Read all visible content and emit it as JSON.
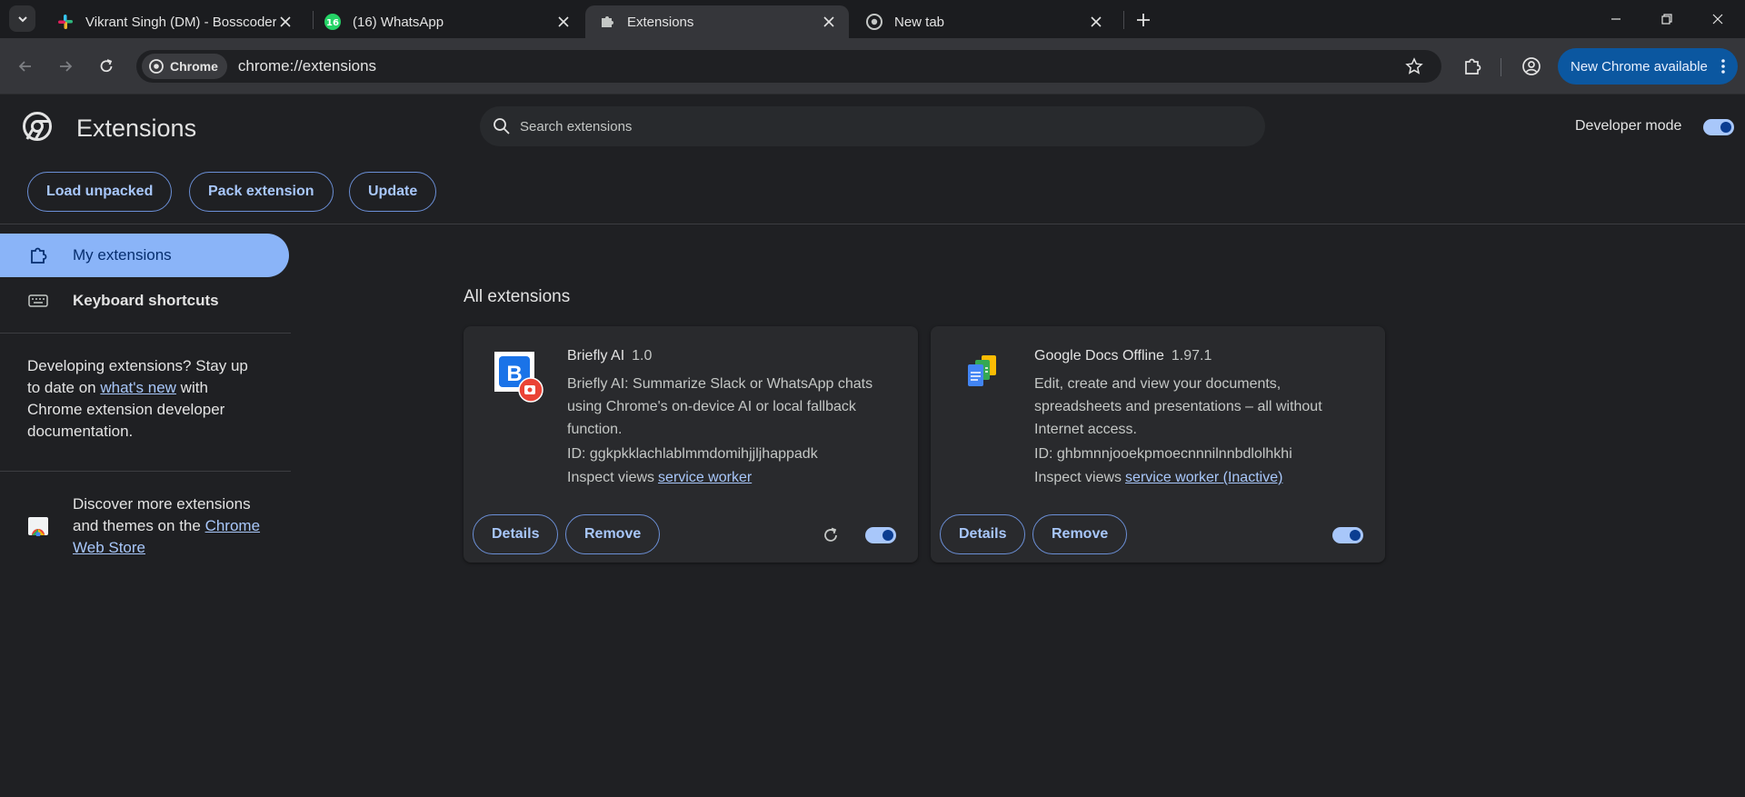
{
  "tabs": [
    {
      "title": "Vikrant Singh (DM) - Bosscoder",
      "favicon": "slack-icon",
      "active": false
    },
    {
      "title": "(16) WhatsApp",
      "favicon": "whatsapp-icon",
      "badge": "16",
      "active": false
    },
    {
      "title": "Extensions",
      "favicon": "puzzle-icon",
      "active": true
    },
    {
      "title": "New tab",
      "favicon": "chrome-icon",
      "active": false
    }
  ],
  "toolbar": {
    "chip_label": "Chrome",
    "url": "chrome://extensions",
    "update_label": "New Chrome available"
  },
  "header": {
    "title": "Extensions",
    "search_placeholder": "Search extensions",
    "dev_mode_label": "Developer mode",
    "dev_mode_on": true,
    "buttons": [
      "Load unpacked",
      "Pack extension",
      "Update"
    ]
  },
  "sidebar": {
    "items": [
      {
        "label": "My extensions",
        "active": true
      },
      {
        "label": "Keyboard shortcuts",
        "active": false
      }
    ],
    "dev_text_before": "Developing extensions? Stay up to date on",
    "dev_link": "what's new",
    "dev_text_after": "with Chrome extension developer documentation.",
    "store_text": "Discover more extensions and themes on the",
    "store_link": "Chrome Web Store"
  },
  "main": {
    "section_title": "All extensions",
    "extensions": [
      {
        "name": "Briefly AI",
        "version": "1.0",
        "description": "Briefly AI: Summarize Slack or WhatsApp chats using Chrome's on-device AI or local fallback function.",
        "id_label": "ID: ggkpkklachlablmmdomihjjljhappadk",
        "inspect_label": "Inspect views",
        "inspect_link": "service worker",
        "details_label": "Details",
        "remove_label": "Remove",
        "enabled": true
      },
      {
        "name": "Google Docs Offline",
        "version": "1.97.1",
        "description": "Edit, create and view your documents, spreadsheets and presentations – all without Internet access.",
        "id_label": "ID: ghbmnnjooekpmoecnnnilnnbdlolhkhi",
        "inspect_label": "Inspect views",
        "inspect_link": "service worker (Inactive)",
        "details_label": "Details",
        "remove_label": "Remove",
        "enabled": true
      }
    ]
  },
  "colors": {
    "accent": "#a8c7fa",
    "active_nav": "#8ab4f8",
    "update_pill": "#0b57a0",
    "card_bg": "#292a2d",
    "page_bg": "#1f2023"
  }
}
